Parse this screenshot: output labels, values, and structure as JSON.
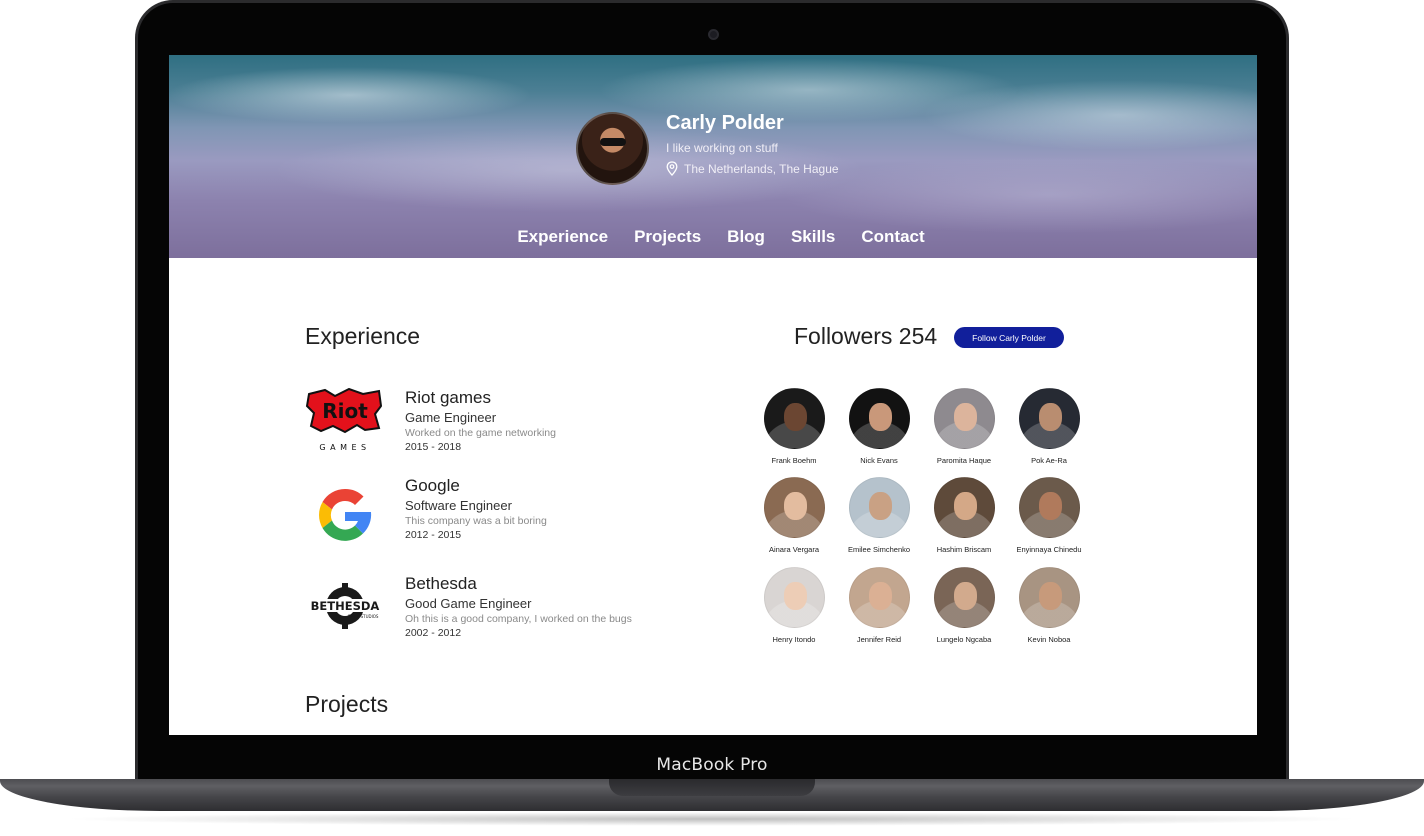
{
  "device": {
    "label": "MacBook Pro"
  },
  "profile": {
    "name": "Carly Polder",
    "bio": "I like working on stuff",
    "location": "The Netherlands, The Hague"
  },
  "nav": [
    "Experience",
    "Projects",
    "Blog",
    "Skills",
    "Contact"
  ],
  "experience": {
    "title": "Experience",
    "items": [
      {
        "company": "Riot games",
        "role": "Game Engineer",
        "description": "Worked on the game networking",
        "years": "2015 - 2018",
        "logo": "riot-games-logo",
        "logo_text": "Riot",
        "logo_subtext": "GAMES"
      },
      {
        "company": "Google",
        "role": "Software Engineer",
        "description": "This company was a bit boring",
        "years": "2012 - 2015",
        "logo": "google-logo"
      },
      {
        "company": "Bethesda",
        "role": "Good Game Engineer",
        "description": "Oh this is a good company, I worked on the bugs",
        "years": "2002 - 2012",
        "logo": "bethesda-logo",
        "logo_text": "BETHESDA",
        "logo_subtext": "GAME STUDIOS"
      }
    ]
  },
  "followers": {
    "title": "Followers 254",
    "follow_button": "Follow Carly Polder",
    "people": [
      {
        "name": "Frank Boehm",
        "bg": "#1a1a1a",
        "face": "#6b4632"
      },
      {
        "name": "Nick Evans",
        "bg": "#121212",
        "face": "#c9987a"
      },
      {
        "name": "Paromita Haque",
        "bg": "#8e8a8f",
        "face": "#dcb49c"
      },
      {
        "name": "Pok Ae-Ra",
        "bg": "#262a33",
        "face": "#b98d70"
      },
      {
        "name": "Ainara Vergara",
        "bg": "#8a6a52",
        "face": "#e3bc9f"
      },
      {
        "name": "Emilee Simchenko",
        "bg": "#b5c2cc",
        "face": "#c9a184"
      },
      {
        "name": "Hashim Briscam",
        "bg": "#5e4a3a",
        "face": "#d4a887"
      },
      {
        "name": "Enyinnaya Chinedu",
        "bg": "#6b5a4b",
        "face": "#b07a5c"
      },
      {
        "name": "Henry Itondo",
        "bg": "#d9d5d3",
        "face": "#edcdb6"
      },
      {
        "name": "Jennifer Reid",
        "bg": "#c2a68f",
        "face": "#dbb094"
      },
      {
        "name": "Lungelo Ngcaba",
        "bg": "#7a6556",
        "face": "#d2aa8d"
      },
      {
        "name": "Kevin Noboa",
        "bg": "#a89482",
        "face": "#c79a7b"
      }
    ]
  },
  "projects": {
    "title": "Projects"
  },
  "colors": {
    "follow_button": "#111f9b",
    "text": "#222222",
    "muted": "#8a8a8a"
  }
}
